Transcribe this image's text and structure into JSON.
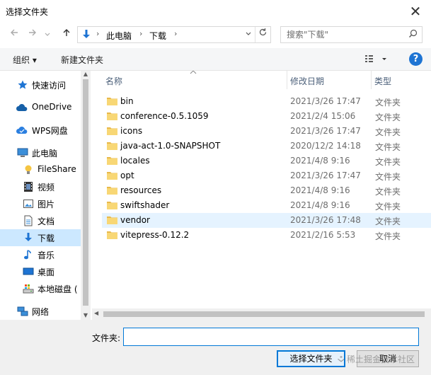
{
  "window": {
    "title": "选择文件夹",
    "close_glyph": "✕"
  },
  "nav": {
    "back_icon": "arrow-left-icon",
    "forward_icon": "arrow-right-icon",
    "recent_icon": "chevron-down-icon",
    "up_icon": "arrow-up-icon",
    "breadcrumbs": [
      "此电脑",
      "下载"
    ],
    "search_placeholder": "搜索\"下载\""
  },
  "toolbar": {
    "organize_label": "组织 ▾",
    "new_folder_label": "新建文件夹",
    "help_label": "?"
  },
  "sidebar": {
    "items": [
      {
        "label": "快速访问",
        "icon": "star-icon"
      },
      {
        "label": "OneDrive",
        "icon": "cloud-icon"
      },
      {
        "label": "WPS网盘",
        "icon": "wps-cloud-icon"
      },
      {
        "label": "此电脑",
        "icon": "computer-icon"
      },
      {
        "label": "FileShare",
        "icon": "lightbulb-icon"
      },
      {
        "label": "视频",
        "icon": "film-icon"
      },
      {
        "label": "图片",
        "icon": "picture-icon"
      },
      {
        "label": "文档",
        "icon": "document-icon"
      },
      {
        "label": "下载",
        "icon": "download-icon",
        "selected": true
      },
      {
        "label": "音乐",
        "icon": "music-icon"
      },
      {
        "label": "桌面",
        "icon": "desktop-icon"
      },
      {
        "label": "本地磁盘 (",
        "icon": "disk-icon"
      },
      {
        "label": "网络",
        "icon": "network-icon"
      }
    ]
  },
  "columns": {
    "name": "名称",
    "date": "修改日期",
    "type": "类型"
  },
  "files": [
    {
      "name": "bin",
      "date": "2021/3/26 17:47",
      "type": "文件夹"
    },
    {
      "name": "conference-0.5.1059",
      "date": "2021/2/4 15:06",
      "type": "文件夹"
    },
    {
      "name": "icons",
      "date": "2021/3/26 17:47",
      "type": "文件夹"
    },
    {
      "name": "java-act-1.0-SNAPSHOT",
      "date": "2020/12/2 14:18",
      "type": "文件夹"
    },
    {
      "name": "locales",
      "date": "2021/4/8 9:16",
      "type": "文件夹"
    },
    {
      "name": "opt",
      "date": "2021/3/26 17:47",
      "type": "文件夹"
    },
    {
      "name": "resources",
      "date": "2021/4/8 9:16",
      "type": "文件夹"
    },
    {
      "name": "swiftshader",
      "date": "2021/4/8 9:16",
      "type": "文件夹"
    },
    {
      "name": "vendor",
      "date": "2021/3/26 17:48",
      "type": "文件夹",
      "hover": true
    },
    {
      "name": "vitepress-0.12.2",
      "date": "2021/2/16 5:53",
      "type": "文件夹"
    }
  ],
  "footer": {
    "folder_label": "文件夹:",
    "folder_value": "",
    "select_button": "选择文件夹",
    "cancel_button": "取消",
    "watermark": "稀土掘金技术社区"
  },
  "colors": {
    "accent": "#0078d7",
    "selected_bg": "#cce8ff",
    "hover_bg": "#e5f3ff",
    "folder": "#f8d775"
  }
}
